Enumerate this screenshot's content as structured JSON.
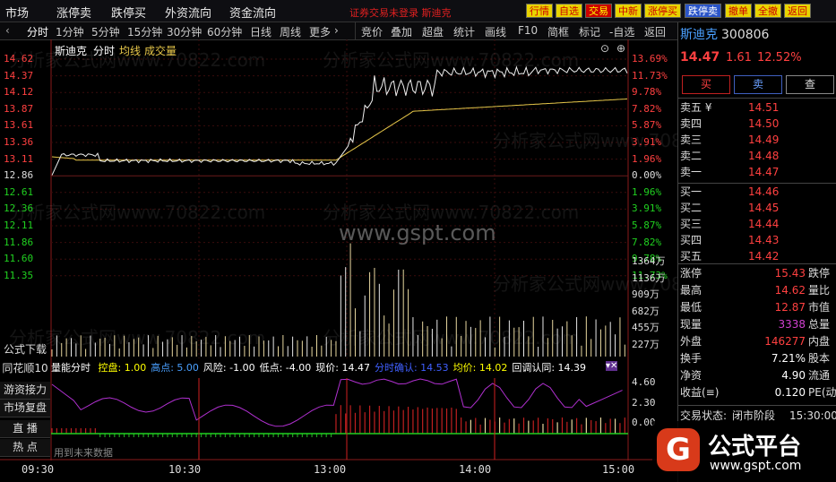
{
  "topnav": [
    "市场",
    "涨停卖",
    "跌停买",
    "外资流向",
    "资金流向"
  ],
  "notice": "证券交易未登录  斯迪克",
  "topbuttons": [
    "行情",
    "自选",
    "交易",
    "中新",
    "涨停买",
    "跌停卖",
    "撤单",
    "全撤",
    "返回"
  ],
  "periods": [
    "分时",
    "1分钟",
    "5分钟",
    "15分钟",
    "30分钟",
    "60分钟",
    "日线",
    "周线",
    "更多"
  ],
  "tools": [
    "竞价",
    "叠加",
    "超盘",
    "统计",
    "画线",
    "F10",
    "简框",
    "标记",
    "-自选",
    "返回"
  ],
  "chart_header": {
    "name": "斯迪克",
    "mode": "分时",
    "avg": "均线",
    "vol": "成交量"
  },
  "price_axis_left": [
    "14.62",
    "14.37",
    "14.12",
    "13.87",
    "13.61",
    "13.36",
    "13.11",
    "12.86",
    "12.61",
    "12.36",
    "12.11",
    "11.86",
    "11.60",
    "11.35"
  ],
  "pct_axis_right": [
    "13.69%",
    "11.73%",
    "9.78%",
    "7.82%",
    "5.87%",
    "3.91%",
    "1.96%",
    "0.00%",
    "1.96%",
    "3.91%",
    "5.87%",
    "7.82%",
    "9.78%",
    "11.73%"
  ],
  "vol_axis": [
    "1364万",
    "1136万",
    "909万",
    "682万",
    "455万",
    "227万"
  ],
  "ind_axis": [
    "4.60",
    "2.30",
    "0.00"
  ],
  "time_axis": [
    "09:30",
    "10:30",
    "13:00",
    "14:00",
    "15:00"
  ],
  "left_buttons": [
    "公式下载",
    "同花顺10",
    "游资接力",
    "市场复盘",
    "直  播",
    "热  点"
  ],
  "indicator_line": {
    "name": "量能分时",
    "items": [
      {
        "label": "控盘:",
        "value": "1.00",
        "color": "#ffff00"
      },
      {
        "label": "高点:",
        "value": "5.00",
        "color": "#4aa0ff"
      },
      {
        "label": "风险:",
        "value": "-1.00",
        "color": "#ffffff"
      },
      {
        "label": "低点:",
        "value": "-4.00",
        "color": "#ffffff"
      },
      {
        "label": "现价:",
        "value": "14.47",
        "color": "#ffffff"
      },
      {
        "label": "分时确认:",
        "value": "14.53",
        "color": "#4060ff"
      },
      {
        "label": "均价:",
        "value": "14.02",
        "color": "#ffff00"
      },
      {
        "label": "回调认同:",
        "value": "14.39",
        "color": "#ffffff"
      }
    ]
  },
  "future_note": "用到未来数据",
  "stock": {
    "name": "斯迪克",
    "code": "300806",
    "price": "14.47",
    "change": "1.61",
    "pct": "12.52%"
  },
  "actions": [
    "买",
    "卖",
    "查"
  ],
  "asks": [
    {
      "label": "卖五 ¥",
      "price": "14.51"
    },
    {
      "label": "卖四",
      "price": "14.50"
    },
    {
      "label": "卖三",
      "price": "14.49"
    },
    {
      "label": "卖二",
      "price": "14.48"
    },
    {
      "label": "卖一",
      "price": "14.47"
    }
  ],
  "bids": [
    {
      "label": "买一",
      "price": "14.46"
    },
    {
      "label": "买二",
      "price": "14.45"
    },
    {
      "label": "买三",
      "price": "14.44"
    },
    {
      "label": "买四",
      "price": "14.43"
    },
    {
      "label": "买五",
      "price": "14.42"
    }
  ],
  "stats": [
    {
      "l": "涨停",
      "v": "15.43",
      "c": "#ff4040",
      "r": "跌停"
    },
    {
      "l": "最高",
      "v": "14.62",
      "c": "#ff4040",
      "r": "量比"
    },
    {
      "l": "最低",
      "v": "12.87",
      "c": "#ff4040",
      "r": "市值"
    },
    {
      "l": "现量",
      "v": "3338",
      "c": "#d040d0",
      "r": "总量"
    },
    {
      "l": "外盘",
      "v": "146277",
      "c": "#ff4040",
      "r": "内盘"
    },
    {
      "l": "换手",
      "v": "7.21%",
      "c": "#ffffff",
      "r": "股本"
    },
    {
      "l": "净资",
      "v": "4.90",
      "c": "#ffffff",
      "r": "流通"
    },
    {
      "l": "收益(≡)",
      "v": "0.120",
      "c": "#ffffff",
      "r": "PE(动)"
    }
  ],
  "status": {
    "label": "交易状态:",
    "value": "闭市阶段",
    "time": "15:30:00"
  },
  "watermarks": {
    "site1": "分析家公式网www.70822.com",
    "site2": "www.gspt.com",
    "logo_text": "公式平台",
    "logo_url": "www.gspt.com",
    "logo_char": "G"
  }
}
